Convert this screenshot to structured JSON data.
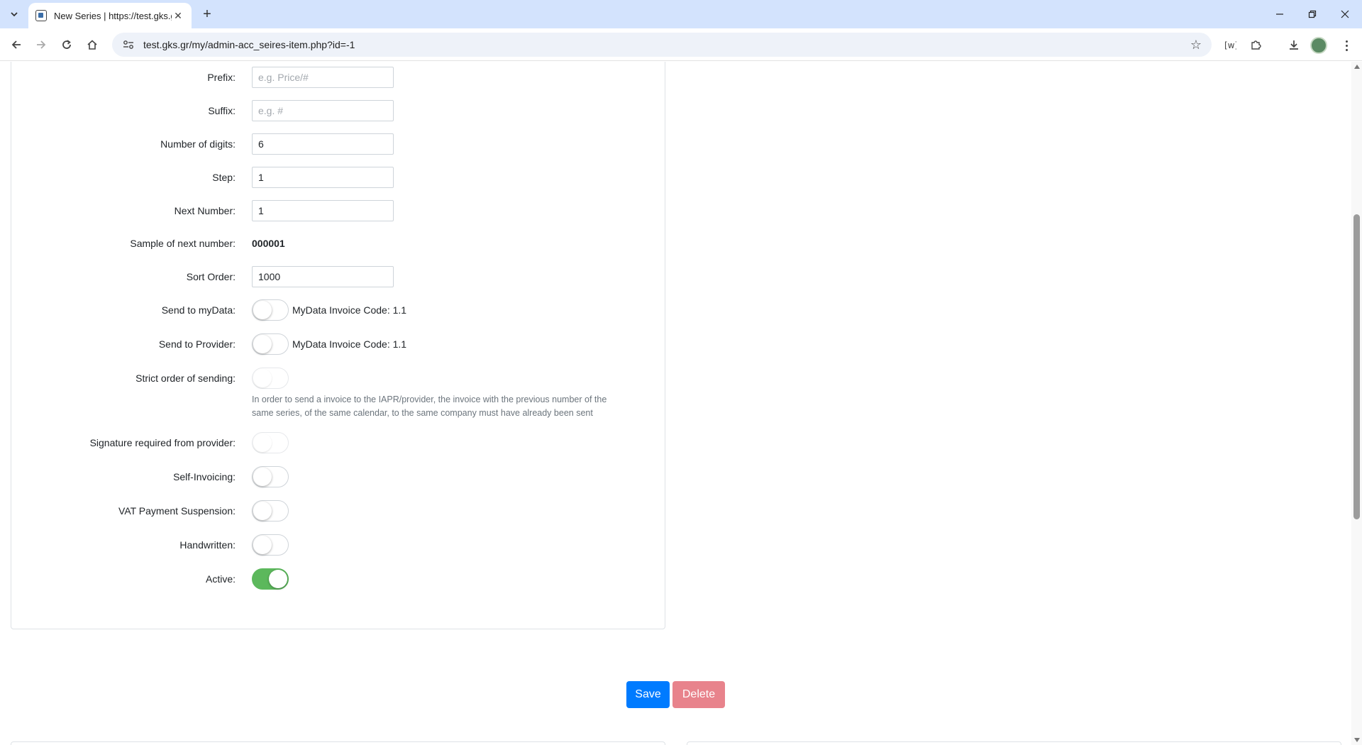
{
  "browser": {
    "tab_title": "New Series | https://test.gks.gr/",
    "url": "test.gks.gr/my/admin-acc_seires-item.php?id=-1"
  },
  "form": {
    "prefix": {
      "label": "Prefix:",
      "placeholder": "e.g. Price/#"
    },
    "suffix": {
      "label": "Suffix:",
      "placeholder": "e.g. #"
    },
    "digits": {
      "label": "Number of digits:",
      "value": "6"
    },
    "step": {
      "label": "Step:",
      "value": "1"
    },
    "next_number": {
      "label": "Next Number:",
      "value": "1"
    },
    "sample": {
      "label": "Sample of next number:",
      "value": "000001"
    },
    "sort_order": {
      "label": "Sort Order:",
      "value": "1000"
    },
    "send_mydata": {
      "label": "Send to myData:",
      "text": "MyData Invoice Code: 1.1",
      "on": false
    },
    "send_provider": {
      "label": "Send to Provider:",
      "text": "MyData Invoice Code: 1.1",
      "on": false
    },
    "strict_order": {
      "label": "Strict order of sending:",
      "help_line1": "In order to send a invoice to the IAPR/provider, the invoice with the previous number of the",
      "help_line2": "same series, of the same calendar, to the same company must have already been sent",
      "on": false
    },
    "signature_required": {
      "label": "Signature required from provider:",
      "on": false
    },
    "self_invoicing": {
      "label": "Self-Invoicing:",
      "on": false
    },
    "vat_suspension": {
      "label": "VAT Payment Suspension:",
      "on": false
    },
    "handwritten": {
      "label": "Handwritten:",
      "on": false
    },
    "active": {
      "label": "Active:",
      "on": true
    }
  },
  "actions": {
    "save_label": "Save",
    "delete_label": "Delete"
  },
  "colors": {
    "primary": "#007bff",
    "danger_disabled": "#e8838c",
    "switch_on": "#5cb85c",
    "chrome_tabstrip": "#d3e3fd"
  }
}
